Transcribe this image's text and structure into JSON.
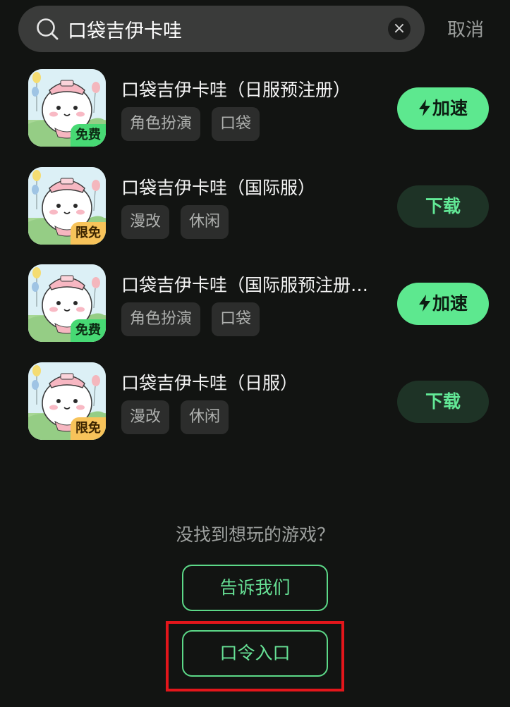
{
  "search": {
    "query": "口袋吉伊卡哇",
    "clear_icon": "×",
    "cancel_label": "取消"
  },
  "results": [
    {
      "title": "口袋吉伊卡哇（日服预注册）",
      "badge": "免费",
      "tags": [
        "角色扮演",
        "口袋"
      ],
      "action": "加速",
      "action_icon": "lightning-icon"
    },
    {
      "title": "口袋吉伊卡哇（国际服）",
      "badge": "限免",
      "tags": [
        "漫改",
        "休闲"
      ],
      "action": "下载"
    },
    {
      "title": "口袋吉伊卡哇（国际服预注册…",
      "badge": "免费",
      "tags": [
        "角色扮演",
        "口袋"
      ],
      "action": "加速",
      "action_icon": "lightning-icon"
    },
    {
      "title": "口袋吉伊卡哇（日服）",
      "badge": "限免",
      "tags": [
        "漫改",
        "休闲"
      ],
      "action": "下载"
    }
  ],
  "footer": {
    "not_found_text": "没找到想玩的游戏？",
    "tell_us_label": "告诉我们",
    "passcode_label": "口令入口"
  },
  "colors": {
    "background": "#121412",
    "accent_green": "#5de88f",
    "highlight_red": "#e3161b"
  }
}
